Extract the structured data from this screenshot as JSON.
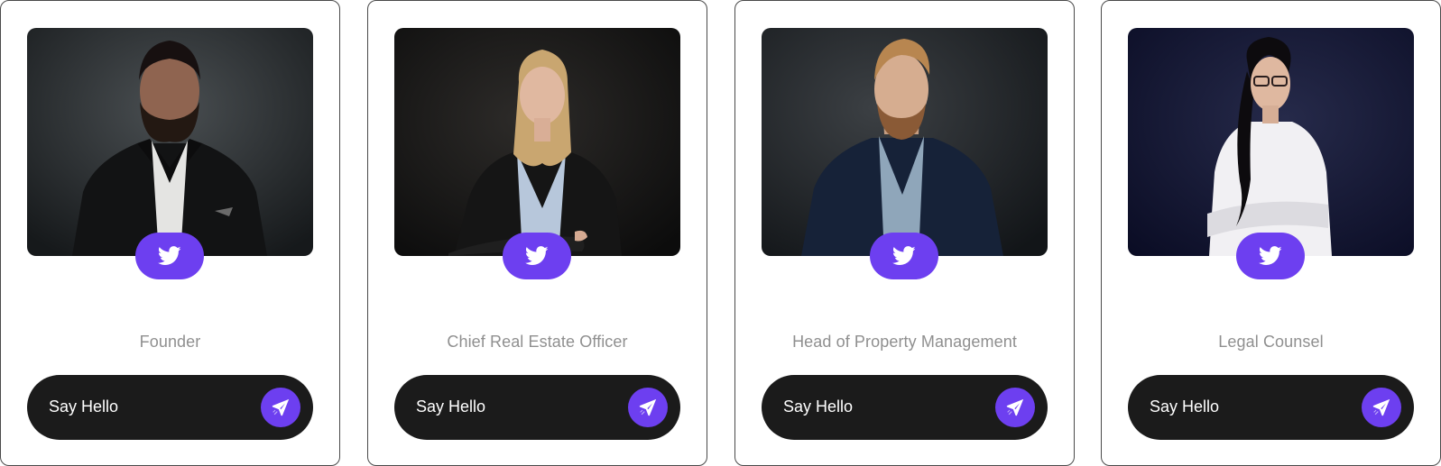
{
  "colors": {
    "accent": "#6d3ff0",
    "button_dark": "#1b1b1b",
    "role_text": "#8f8f8f"
  },
  "team": [
    {
      "photo": "portrait-man-beard-black-blazer",
      "role": "Founder",
      "cta_label": "Say Hello"
    },
    {
      "photo": "portrait-woman-blonde-black-blazer",
      "role": "Chief Real Estate Officer",
      "cta_label": "Say Hello"
    },
    {
      "photo": "portrait-man-blond-navy-suit",
      "role": "Head of Property Management",
      "cta_label": "Say Hello"
    },
    {
      "photo": "portrait-woman-glasses-white-shirt",
      "role": "Legal Counsel",
      "cta_label": "Say Hello"
    }
  ]
}
